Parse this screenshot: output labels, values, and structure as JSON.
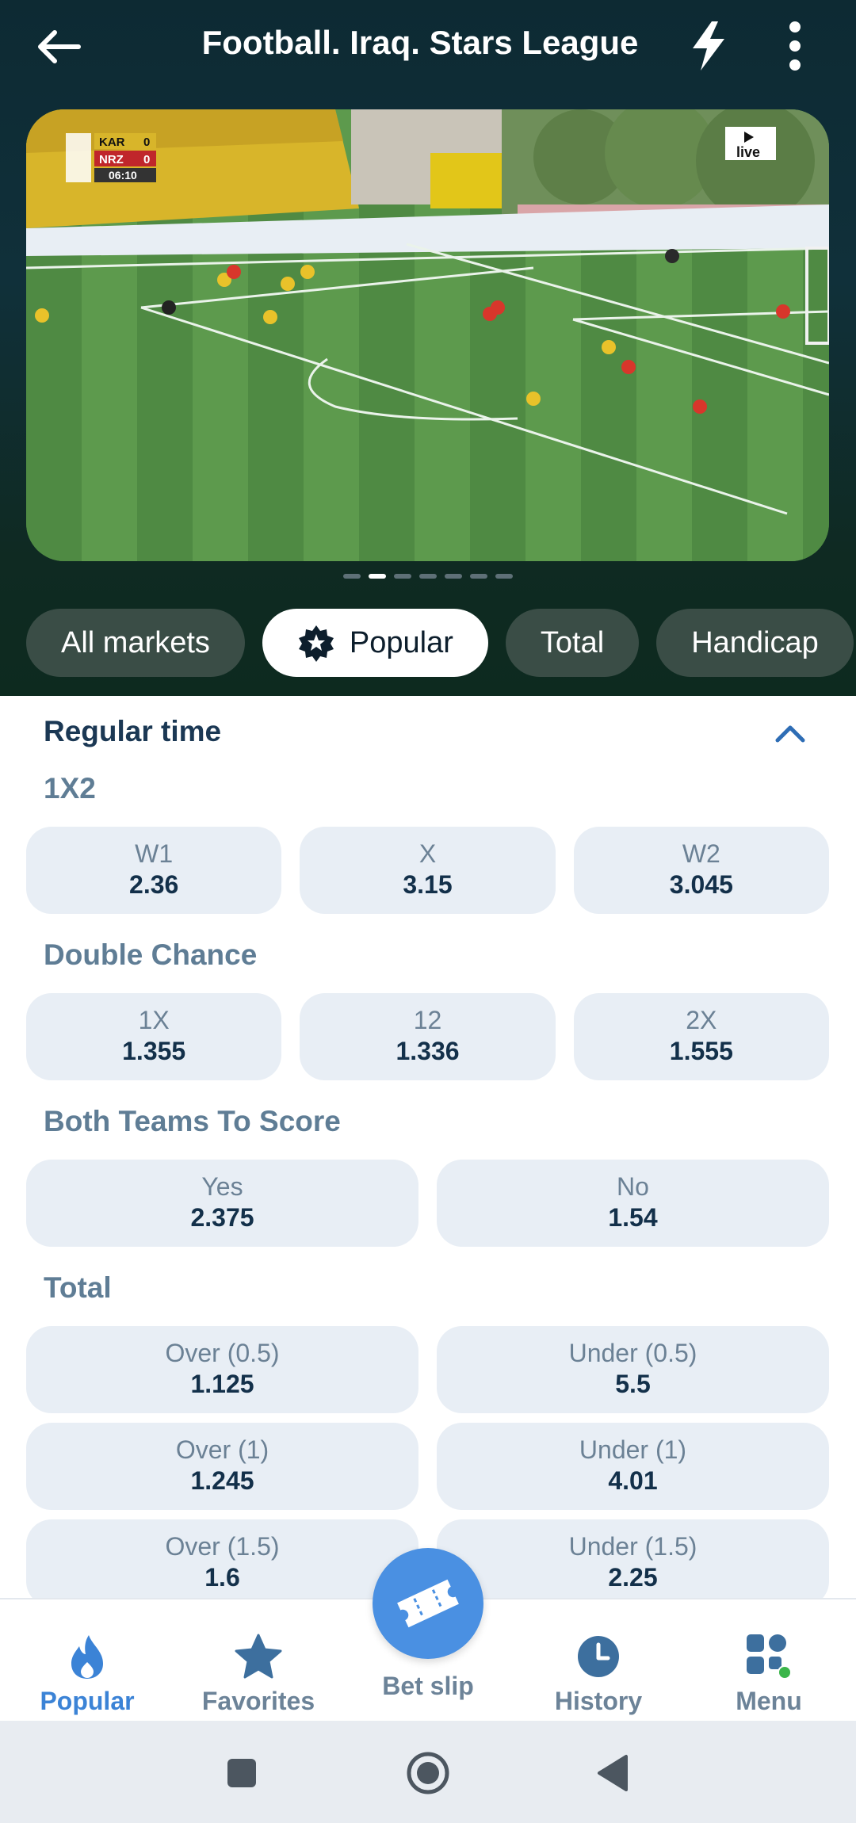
{
  "header": {
    "title": "Football. Iraq. Stars League"
  },
  "video": {
    "scoreboard": {
      "home_abbr": "KAR",
      "away_abbr": "NRZ",
      "home_score": "0",
      "away_score": "0",
      "clock": "06:10"
    },
    "live_badge": "live",
    "carousel_total": 7,
    "carousel_active_index": 1
  },
  "filters": [
    {
      "label": "All markets",
      "active": false
    },
    {
      "label": "Popular",
      "active": true
    },
    {
      "label": "Total",
      "active": false
    },
    {
      "label": "Handicap",
      "active": false
    }
  ],
  "section": {
    "title": "Regular time"
  },
  "markets": {
    "m1x2": {
      "title": "1X2",
      "odds": [
        {
          "label": "W1",
          "value": "2.36"
        },
        {
          "label": "X",
          "value": "3.15"
        },
        {
          "label": "W2",
          "value": "3.045"
        }
      ]
    },
    "double_chance": {
      "title": "Double Chance",
      "odds": [
        {
          "label": "1X",
          "value": "1.355"
        },
        {
          "label": "12",
          "value": "1.336"
        },
        {
          "label": "2X",
          "value": "1.555"
        }
      ]
    },
    "btts": {
      "title": "Both Teams To Score",
      "odds": [
        {
          "label": "Yes",
          "value": "2.375"
        },
        {
          "label": "No",
          "value": "1.54"
        }
      ]
    },
    "total": {
      "title": "Total",
      "rows": [
        [
          {
            "label": "Over (0.5)",
            "value": "1.125"
          },
          {
            "label": "Under (0.5)",
            "value": "5.5"
          }
        ],
        [
          {
            "label": "Over (1)",
            "value": "1.245"
          },
          {
            "label": "Under (1)",
            "value": "4.01"
          }
        ],
        [
          {
            "label": "Over (1.5)",
            "value": "1.6"
          },
          {
            "label": "Under (1.5)",
            "value": "2.25"
          }
        ]
      ]
    }
  },
  "bottom_nav": {
    "popular": "Popular",
    "favorites": "Favorites",
    "bet_slip": "Bet slip",
    "history": "History",
    "menu": "Menu"
  },
  "colors": {
    "accent": "#3b83d6",
    "fab": "#4a90e2",
    "odds_bg": "#e8eef5",
    "odds_value": "#13304a",
    "section_title": "#1b3854",
    "market_title": "#5f7d95",
    "chip_bg": "#3a4d46",
    "header_bg": "#0d2a33",
    "notification_dot": "#3bb54a"
  }
}
